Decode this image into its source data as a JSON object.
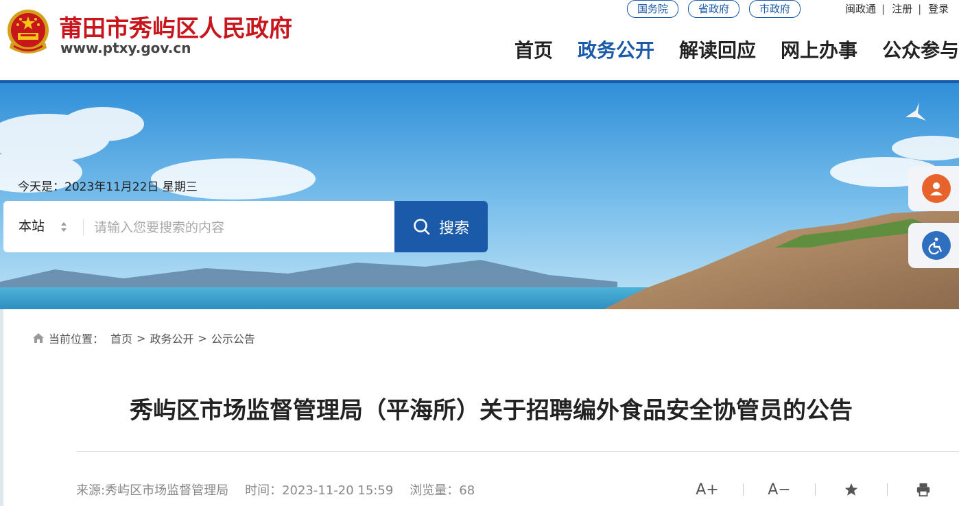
{
  "site": {
    "name": "莆田市秀屿区人民政府",
    "url": "www.ptxy.gov.cn"
  },
  "top_pills": [
    "国务院",
    "省政府",
    "市政府"
  ],
  "util_links": [
    "闽政通",
    "注册",
    "登录"
  ],
  "nav": {
    "items": [
      "首页",
      "政务公开",
      "解读回应",
      "网上办事",
      "公众参与"
    ],
    "active_index": 1
  },
  "banner": {
    "date_prefix": "今天是：",
    "date": "2023年11月22日 星期三"
  },
  "search": {
    "scope": "本站",
    "placeholder": "请输入您要搜索的内容",
    "button_label": "搜索"
  },
  "breadcrumb": {
    "label": "当前位置：",
    "items": [
      "首页",
      "政务公开",
      "公示公告"
    ]
  },
  "article": {
    "title": "秀屿区市场监督管理局（平海所）关于招聘编外食品安全协管员的公告",
    "source": "来源:秀屿区市场监督管理局",
    "time": "时间：2023-11-20 15:59",
    "views": "浏览量：68"
  },
  "tools": {
    "font_larger": "A+",
    "font_smaller": "A−"
  },
  "colors": {
    "brand_blue": "#1a5aa8",
    "brand_red": "#c8161d"
  },
  "icons": {
    "side_buttons": [
      "user-service-icon",
      "accessibility-icon"
    ]
  }
}
